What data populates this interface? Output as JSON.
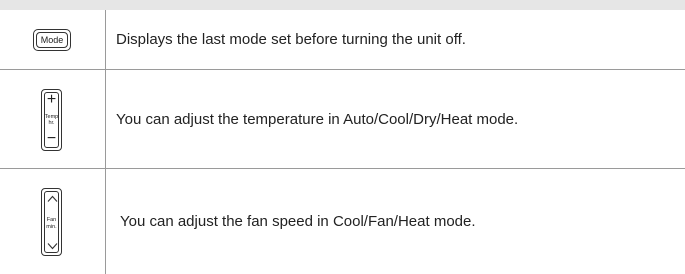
{
  "rows": [
    {
      "button": {
        "label": "Mode"
      },
      "description": "Displays the last mode set before turning the unit off."
    },
    {
      "button": {
        "top_symbol": "+",
        "label_line1": "Temp",
        "label_line2": "hr.",
        "bottom_symbol": "−"
      },
      "description": "You can adjust the temperature in Auto/Cool/Dry/Heat mode."
    },
    {
      "button": {
        "top_symbol": "up-chevron",
        "label_line1": "Fan",
        "label_line2": "min.",
        "bottom_symbol": "down-chevron"
      },
      "description": "You can adjust the fan speed in Cool/Fan/Heat mode."
    }
  ]
}
